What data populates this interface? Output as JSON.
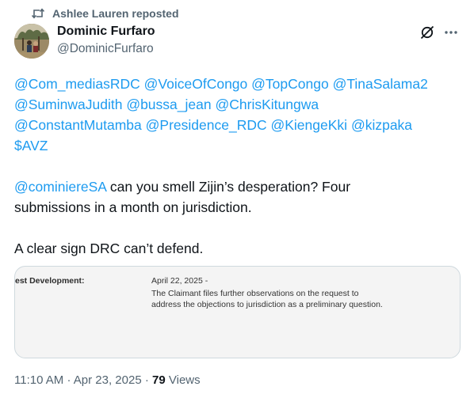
{
  "repost": {
    "icon": "repost-icon",
    "text": "Ashlee Lauren reposted"
  },
  "author": {
    "name": "Dominic Furfaro",
    "handle": "@DominicFurfaro",
    "avatar": "avatar-photo"
  },
  "actions": {
    "grok_icon": "grok-icon",
    "more_icon": "more-icon"
  },
  "tweet": {
    "line1": [
      "@Com_mediasRDC",
      "@VoiceOfCongo",
      "@TopCongo",
      "@TinaSalama2"
    ],
    "line2": [
      "@SuminwaJudith",
      "@bussa_jean",
      "@ChrisKitungwa"
    ],
    "line3": [
      "@ConstantMutamba",
      "@Presidence_RDC",
      "@KiengeKki",
      "@kizpaka"
    ],
    "line4": "$AVZ",
    "mention": "@cominiereSA",
    "text1": " can you smell Zijin’s desperation? Four",
    "text2": "submissions in a month on jurisdiction.",
    "text3": "A clear sign DRC can’t defend."
  },
  "media": {
    "label": "est Development:",
    "date": "April 22, 2025 -",
    "description": "The Claimant files further observations on the request to address the objections to jurisdiction as a preliminary question."
  },
  "meta": {
    "time": "11:10 AM",
    "sep": "·",
    "date": "Apr 23, 2025",
    "views": "79",
    "views_label": "Views"
  },
  "colors": {
    "link": "#1d9bf0",
    "secondary": "#536471",
    "text": "#0f1419"
  }
}
